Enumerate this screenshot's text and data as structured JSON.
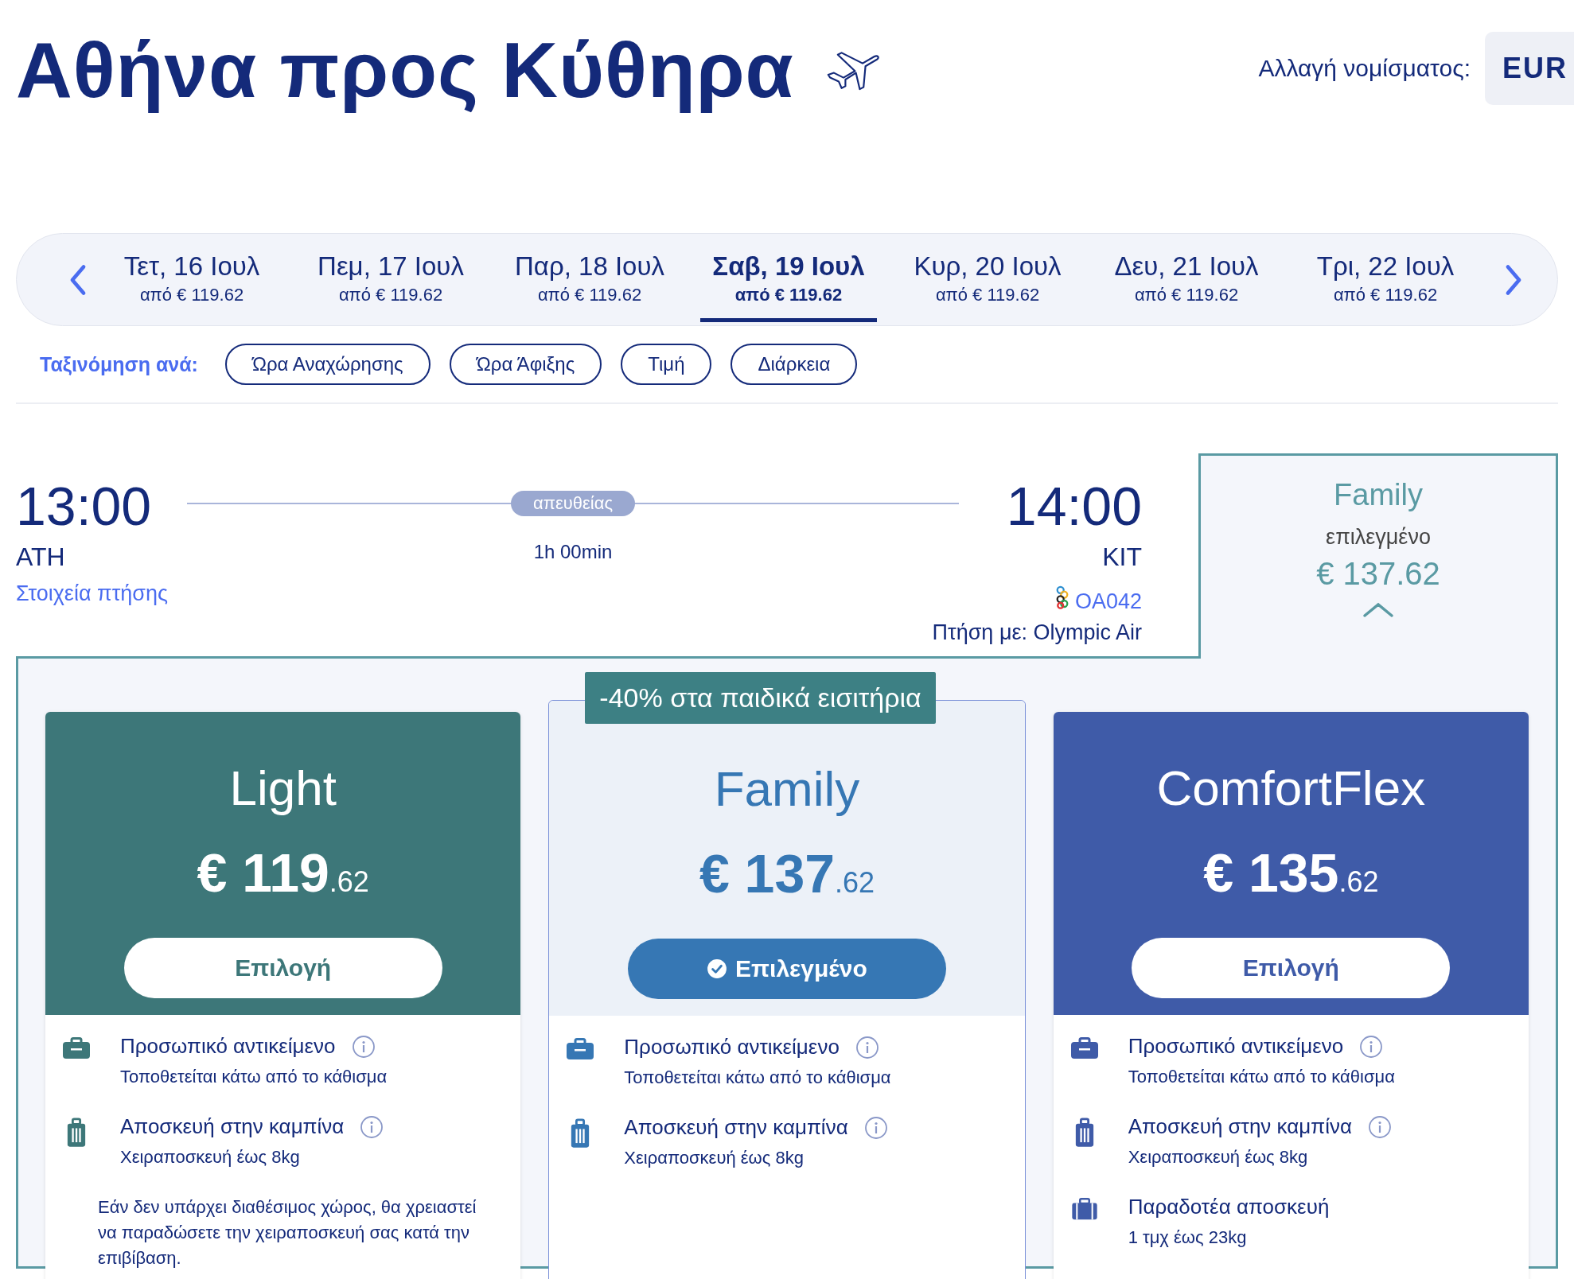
{
  "title": "Αθήνα προς Κύθηρα",
  "currency": {
    "label": "Αλλαγή νομίσματος:",
    "value": "EUR"
  },
  "dates": [
    {
      "day": "Τετ, 16 Ιουλ",
      "price": "από € 119.62",
      "selected": false
    },
    {
      "day": "Πεμ, 17 Ιουλ",
      "price": "από € 119.62",
      "selected": false
    },
    {
      "day": "Παρ, 18 Ιουλ",
      "price": "από € 119.62",
      "selected": false
    },
    {
      "day": "Σαβ, 19 Ιουλ",
      "price": "από € 119.62",
      "selected": true
    },
    {
      "day": "Κυρ, 20 Ιουλ",
      "price": "από € 119.62",
      "selected": false
    },
    {
      "day": "Δευ, 21 Ιουλ",
      "price": "από € 119.62",
      "selected": false
    },
    {
      "day": "Τρι, 22 Ιουλ",
      "price": "από € 119.62",
      "selected": false
    }
  ],
  "sort": {
    "label": "Ταξινόμηση ανά:",
    "options": [
      "Ώρα Αναχώρησης",
      "Ώρα Άφιξης",
      "Τιμή",
      "Διάρκεια"
    ]
  },
  "flight": {
    "departure_time": "13:00",
    "departure_airport": "ATH",
    "details_link": "Στοιχεία πτήσης",
    "stops": "απευθείας",
    "duration": "1h 00min",
    "arrival_time": "14:00",
    "arrival_airport": "KIT",
    "flight_number": "OA042",
    "operator": "Πτήση με: Olympic Air"
  },
  "selected_fare": {
    "name": "Family",
    "status": "επιλεγμένο",
    "price": "€ 137.62",
    "expanded": true
  },
  "fares": [
    {
      "name": "Light",
      "price_main": "€ 119",
      "price_cents": ".62",
      "button": "Επιλογή",
      "selected": false,
      "color": "#3d7779",
      "features": [
        {
          "kind": "personal",
          "title": "Προσωπικό αντικείμενο",
          "subtitle": "Τοποθετείται κάτω από το κάθισμα",
          "info": true
        },
        {
          "kind": "cabin",
          "title": "Αποσκευή στην καμπίνα",
          "subtitle": "Χειραποσκευή έως 8kg",
          "info": true
        }
      ],
      "note": "Εάν δεν υπάρχει διαθέσιμος χώρος, θα χρειαστεί να παραδώσετε την χειραποσκευή σας κατά την επιβίβαση."
    },
    {
      "name": "Family",
      "price_main": "€ 137",
      "price_cents": ".62",
      "button": "Επιλεγμένο",
      "selected": true,
      "color": "#3677b4",
      "badge": "-40% στα παιδικά εισιτήρια",
      "features": [
        {
          "kind": "personal",
          "title": "Προσωπικό αντικείμενο",
          "subtitle": "Τοποθετείται κάτω από το κάθισμα",
          "info": true
        },
        {
          "kind": "cabin",
          "title": "Αποσκευή στην καμπίνα",
          "subtitle": "Χειραποσκευή έως 8kg",
          "info": true
        }
      ]
    },
    {
      "name": "ComfortFlex",
      "price_main": "€ 135",
      "price_cents": ".62",
      "button": "Επιλογή",
      "selected": false,
      "color": "#3f5ba8",
      "features": [
        {
          "kind": "personal",
          "title": "Προσωπικό αντικείμενο",
          "subtitle": "Τοποθετείται κάτω από το κάθισμα",
          "info": true
        },
        {
          "kind": "cabin",
          "title": "Αποσκευή στην καμπίνα",
          "subtitle": "Χειραποσκευή έως 8kg",
          "info": true
        },
        {
          "kind": "checked",
          "title": "Παραδοτέα αποσκευή",
          "subtitle": "1 τμχ έως 23kg",
          "info": false
        }
      ]
    }
  ]
}
